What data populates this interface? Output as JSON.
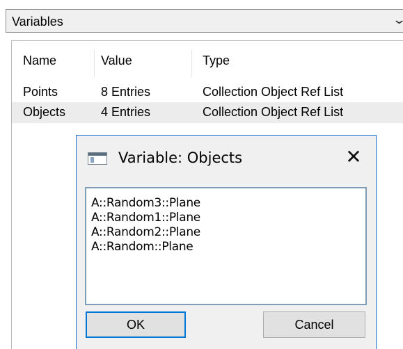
{
  "combo": {
    "label": "Variables",
    "arrow_icon": "chevron-down-icon"
  },
  "table": {
    "headers": [
      "Name",
      "Value",
      "Type"
    ],
    "rows": [
      {
        "name": "Points",
        "value": "8 Entries",
        "type": "Collection Object Ref List",
        "selected": false
      },
      {
        "name": "Objects",
        "value": "4 Entries",
        "type": "Collection Object Ref List",
        "selected": true
      }
    ]
  },
  "dialog": {
    "title": "Variable: Objects",
    "close_symbol": "✕",
    "items": [
      "A::Random3::Plane",
      "A::Random1::Plane",
      "A::Random2::Plane",
      "A::Random::Plane"
    ],
    "ok_label": "OK",
    "cancel_label": "Cancel"
  },
  "colors": {
    "accent": "#0078d7",
    "selection": "#ececec"
  }
}
